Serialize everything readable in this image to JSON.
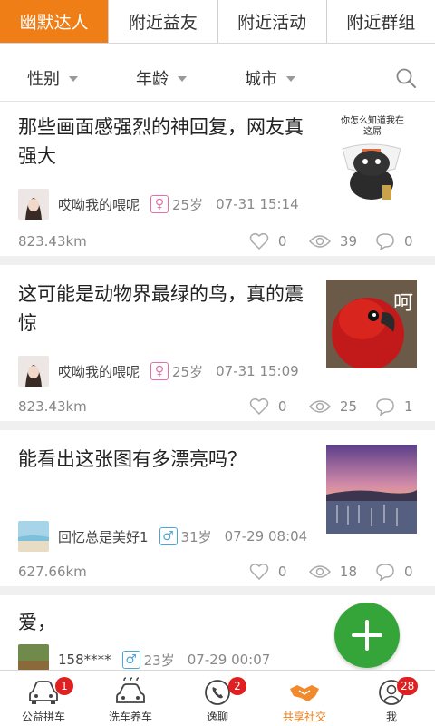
{
  "tabs": [
    {
      "label": "幽默达人",
      "active": true
    },
    {
      "label": "附近益友",
      "active": false
    },
    {
      "label": "附近活动",
      "active": false
    },
    {
      "label": "附近群组",
      "active": false
    }
  ],
  "filters": {
    "gender": "性别",
    "age": "年龄",
    "city": "城市",
    "search_icon": "search-icon"
  },
  "posts": [
    {
      "title": "那些画面感强烈的神回复，网友真强大",
      "thumb_caption": "你怎么知道我在这屌",
      "author": "哎呦我的喂呢",
      "gender": "female",
      "gender_symbol": "♀",
      "age": "25岁",
      "time": "07-31 15:14",
      "distance": "823.43km",
      "likes": "0",
      "views": "39",
      "comments": "0"
    },
    {
      "title": "这可能是动物界最绿的鸟，真的震惊",
      "thumb_caption": "呵",
      "author": "哎呦我的喂呢",
      "gender": "female",
      "gender_symbol": "♀",
      "age": "25岁",
      "time": "07-31 15:09",
      "distance": "823.43km",
      "likes": "0",
      "views": "25",
      "comments": "1"
    },
    {
      "title": "能看出这张图有多漂亮吗？",
      "author": "回忆总是美好1",
      "gender": "male",
      "gender_symbol": "♂",
      "age": "31岁",
      "time": "07-29 08:04",
      "distance": "627.66km",
      "likes": "0",
      "views": "18",
      "comments": "0"
    },
    {
      "title": "爱，",
      "author": "158****",
      "gender": "male",
      "gender_symbol": "♂",
      "age": "23岁",
      "time": "07-29 00:07"
    }
  ],
  "fab": {
    "icon": "plus-icon"
  },
  "bottom_nav": [
    {
      "label": "公益拼车",
      "icon": "car-icon",
      "badge": "1",
      "active": false
    },
    {
      "label": "洗车养车",
      "icon": "car-wash-icon",
      "badge": "",
      "active": false
    },
    {
      "label": "逸聊",
      "icon": "phone-icon",
      "badge": "2",
      "active": false
    },
    {
      "label": "共享社交",
      "icon": "handshake-icon",
      "badge": "",
      "active": true
    },
    {
      "label": "我",
      "icon": "user-icon",
      "badge": "28",
      "active": false
    }
  ],
  "colors": {
    "accent": "#ef7e16",
    "fab": "#35a53a",
    "badge": "#e02020",
    "female": "#e56ea9",
    "male": "#48a8d9"
  }
}
